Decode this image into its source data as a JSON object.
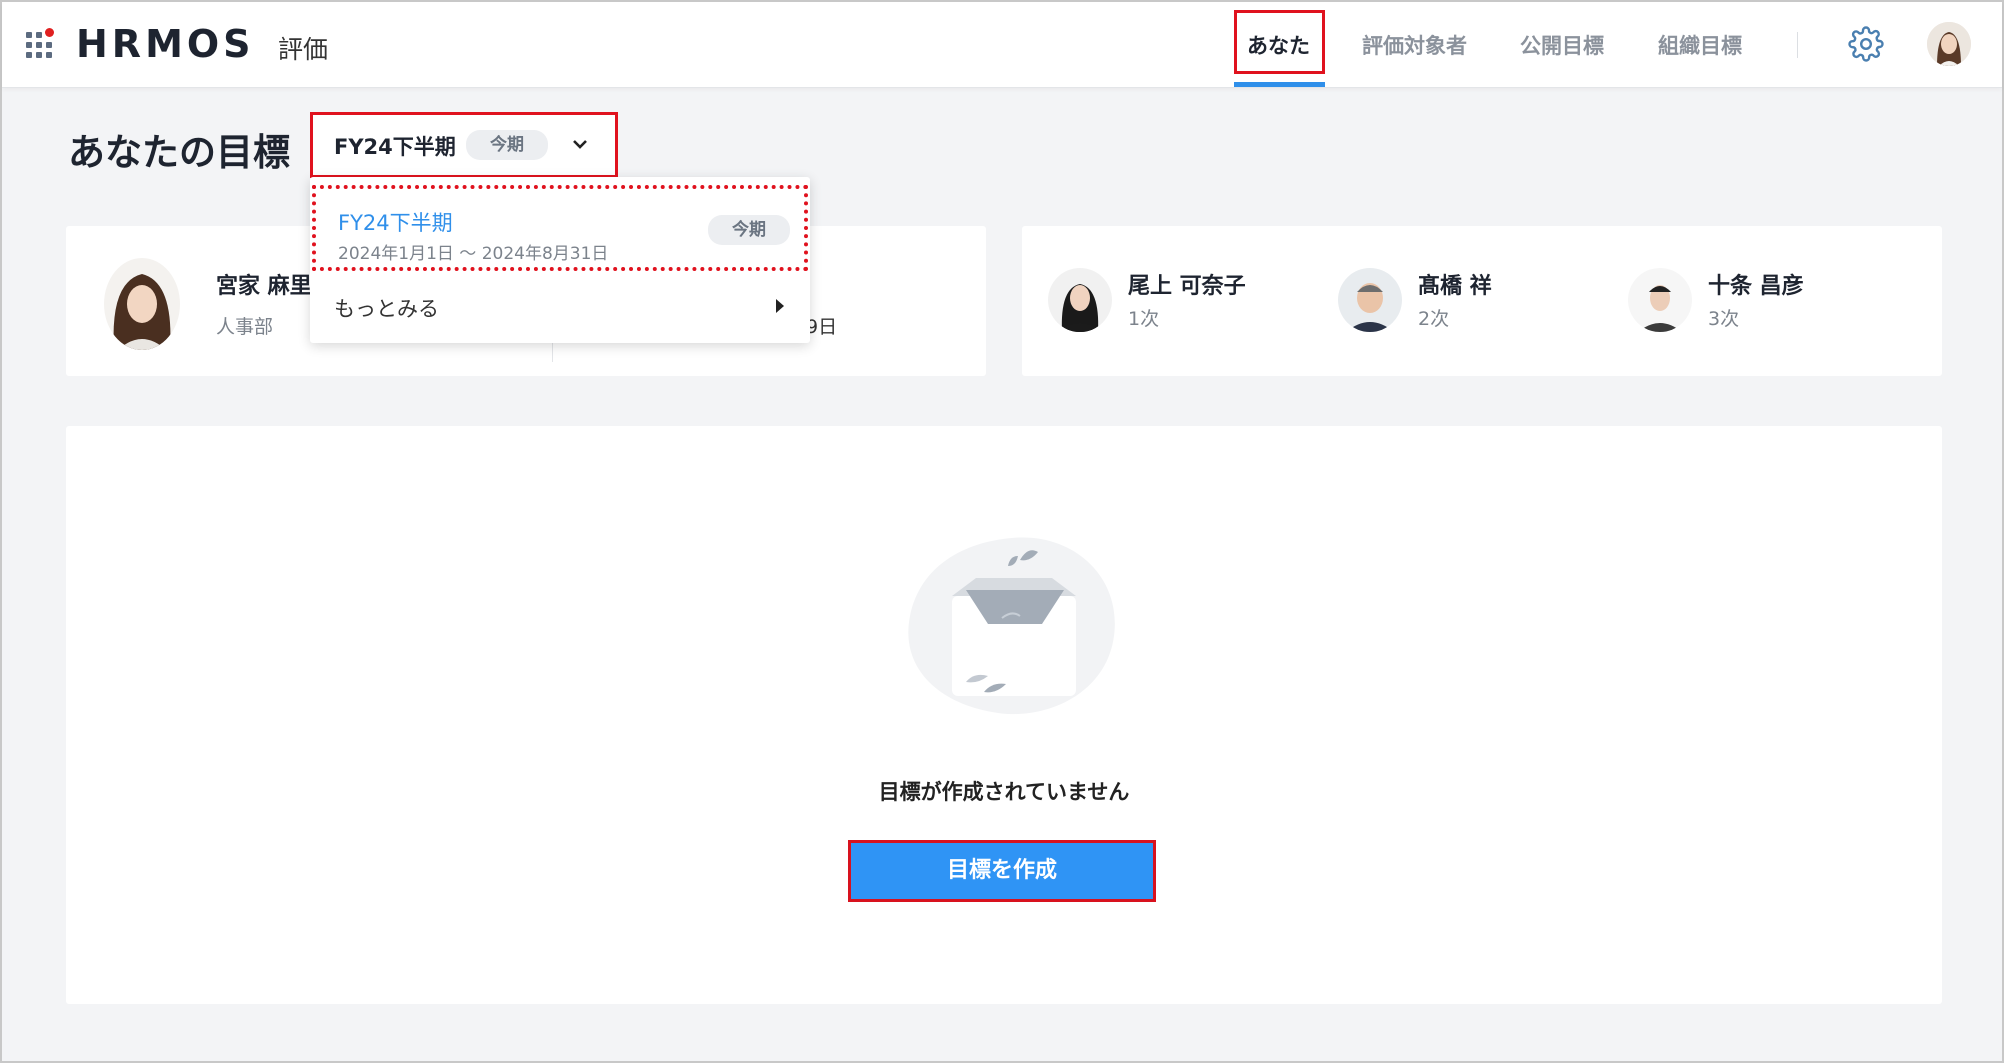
{
  "header": {
    "app_name": "HRMOS",
    "app_sub": "評価",
    "nav": [
      {
        "label": "あなた",
        "active": true
      },
      {
        "label": "評価対象者"
      },
      {
        "label": "公開目標"
      },
      {
        "label": "組織目標"
      }
    ],
    "icons": [
      "apps-grid-icon",
      "gear-icon",
      "user-avatar"
    ]
  },
  "page": {
    "title": "あなたの目標",
    "period": {
      "selected": "FY24下半期",
      "badge": "今期"
    }
  },
  "dropdown": {
    "items": [
      {
        "title": "FY24下半期",
        "date": "2024年1月1日 〜 2024年8月31日",
        "badge": "今期"
      }
    ],
    "more_label": "もっとみる"
  },
  "profile": {
    "name": "宮家 麻里",
    "dept": "人事部",
    "date_fragment": "9日"
  },
  "evaluators": [
    {
      "name": "尾上 可奈子",
      "level": "1次"
    },
    {
      "name": "髙橋 祥",
      "level": "2次"
    },
    {
      "name": "十条 昌彦",
      "level": "3次"
    }
  ],
  "empty_state": {
    "message": "目標が作成されていません",
    "button": "目標を作成"
  },
  "colors": {
    "accent": "#2f8fea",
    "highlight": "#e0121e",
    "bg": "#f3f4f6"
  }
}
